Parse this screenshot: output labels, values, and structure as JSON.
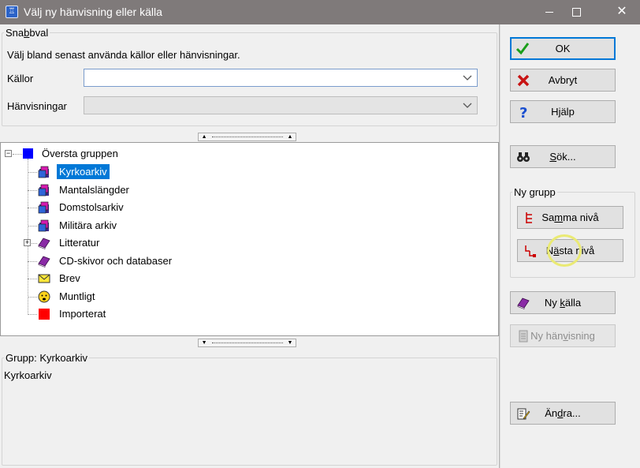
{
  "window": {
    "title": "Välj ny hänvisning eller källa",
    "minimize": "minimize",
    "maximize": "maximize",
    "close": "✕"
  },
  "snabbval": {
    "legend_pre": "Sna",
    "legend_u": "b",
    "legend_post": "bval",
    "hint": "Välj bland senast använda källor eller hänvisningar.",
    "kallor_label": "Källor",
    "kallor_value": "",
    "hanvisningar_label": "Hänvisningar",
    "hanvisningar_value": ""
  },
  "tree": {
    "root": "Översta gruppen",
    "items": [
      {
        "label": "Kyrkoarkiv",
        "icon": "archive-icon",
        "selected": true
      },
      {
        "label": "Mantalslängder",
        "icon": "archive-icon"
      },
      {
        "label": "Domstolsarkiv",
        "icon": "archive-icon"
      },
      {
        "label": "Militära arkiv",
        "icon": "archive-icon"
      },
      {
        "label": "Litteratur",
        "icon": "book-icon",
        "expandable": true
      },
      {
        "label": "CD-skivor och databaser",
        "icon": "book-icon"
      },
      {
        "label": "Brev",
        "icon": "envelope-icon"
      },
      {
        "label": "Muntligt",
        "icon": "face-icon"
      },
      {
        "label": "Importerat",
        "icon": "red-square-icon"
      }
    ],
    "expand_plus": "+",
    "collapse_minus": "−"
  },
  "details": {
    "legend": "Grupp: Kyrkoarkiv",
    "text": "Kyrkoarkiv"
  },
  "buttons": {
    "ok": "OK",
    "cancel": "Avbryt",
    "help_pre": "H",
    "help_u": "j",
    "help_post": "älp",
    "search_u": "S",
    "search_post": "ök...",
    "ny_grupp_legend": "Ny grupp",
    "same_level_pre": "Sa",
    "same_level_u": "m",
    "same_level_post": "ma nivå",
    "next_level_pre": "N",
    "next_level_u": "ä",
    "next_level_post": "sta nivå",
    "new_source_pre": "Ny ",
    "new_source_u": "k",
    "new_source_post": "älla",
    "new_reference_pre": "Ny hän",
    "new_reference_u": "v",
    "new_reference_post": "isning",
    "edit_pre": "Än",
    "edit_u": "d",
    "edit_post": "ra..."
  },
  "colors": {
    "titlebar": "#7f7a7a",
    "selection": "#0078d7",
    "default_button_border": "#0078d7",
    "root_square": "#0000ff",
    "import_square": "#ff0000"
  }
}
